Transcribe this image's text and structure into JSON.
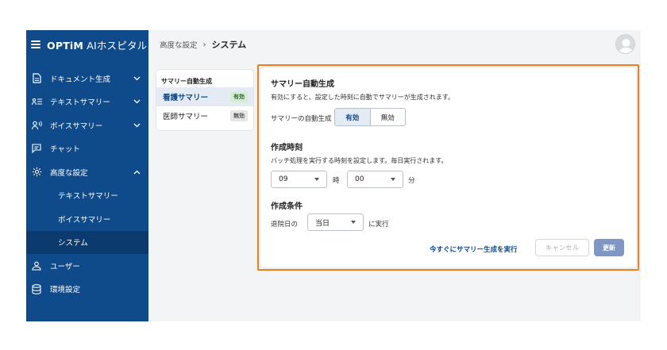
{
  "brand": {
    "name_bold": "OPTiM",
    "name_light": " AIホスピタル"
  },
  "sidebar": {
    "items": [
      {
        "label": "ドキュメント生成",
        "icon": "document-icon",
        "expandable": true
      },
      {
        "label": "テキストサマリー",
        "icon": "text-summary-icon",
        "expandable": true
      },
      {
        "label": "ボイスサマリー",
        "icon": "voice-icon",
        "expandable": true
      },
      {
        "label": "チャット",
        "icon": "chat-icon",
        "expandable": false
      },
      {
        "label": "高度な設定",
        "icon": "gear-icon",
        "expandable": true,
        "expanded": true
      }
    ],
    "subitems": [
      {
        "label": "テキストサマリー"
      },
      {
        "label": "ボイスサマリー"
      },
      {
        "label": "システム",
        "active": true
      }
    ],
    "bottom_items": [
      {
        "label": "ユーザー",
        "icon": "user-icon"
      },
      {
        "label": "環境設定",
        "icon": "database-icon"
      }
    ]
  },
  "header": {
    "breadcrumb_parent": "高度な設定",
    "breadcrumb_sep": "›",
    "breadcrumb_current": "システム"
  },
  "list_panel": {
    "title": "サマリー自動生成",
    "rows": [
      {
        "name": "看護サマリー",
        "badge": "有効",
        "active": true
      },
      {
        "name": "医師サマリー",
        "badge": "無効",
        "active": false
      }
    ]
  },
  "card": {
    "section1": {
      "title": "サマリー自動生成",
      "desc": "有効にすると、設定した時刻に自動でサマリーが生成されます。",
      "field_label": "サマリーの自動生成",
      "options": [
        "有効",
        "無効"
      ],
      "selected": "有効"
    },
    "section2": {
      "title": "作成時刻",
      "desc": "バッチ処理を実行する時刻を設定します。毎日実行されます。",
      "hour": "09",
      "hour_unit": "時",
      "minute": "00",
      "minute_unit": "分"
    },
    "section3": {
      "title": "作成条件",
      "prefix": "退院日の",
      "value": "当日",
      "suffix": "に実行"
    },
    "actions": {
      "run_now": "今すぐにサマリー生成を実行",
      "cancel": "キャンセル",
      "update": "更新"
    }
  },
  "colors": {
    "sidebar": "#0f4a8a",
    "sidebar_active": "#0b3a6e",
    "highlight_border": "#ef7d1a",
    "link": "#0f4a8a",
    "update_button": "#7f97c2"
  }
}
